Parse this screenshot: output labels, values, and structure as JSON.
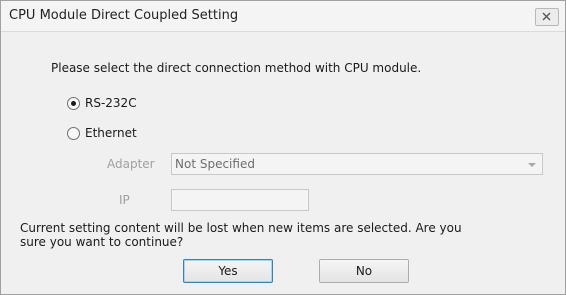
{
  "window": {
    "title": "CPU Module Direct Coupled Setting",
    "close_icon": "close-icon"
  },
  "dialog": {
    "instruction": "Please select the direct connection method with CPU module.",
    "options": [
      {
        "label": "RS-232C",
        "selected": true
      },
      {
        "label": "Ethernet",
        "selected": false
      }
    ],
    "adapter_label": "Adapter",
    "adapter_value": "Not Specified",
    "ip_label": "IP",
    "ip_value": "",
    "warning": "Current setting content will be lost when new items are selected. Are you sure you want to continue?",
    "yes_label": "Yes",
    "no_label": "No"
  }
}
